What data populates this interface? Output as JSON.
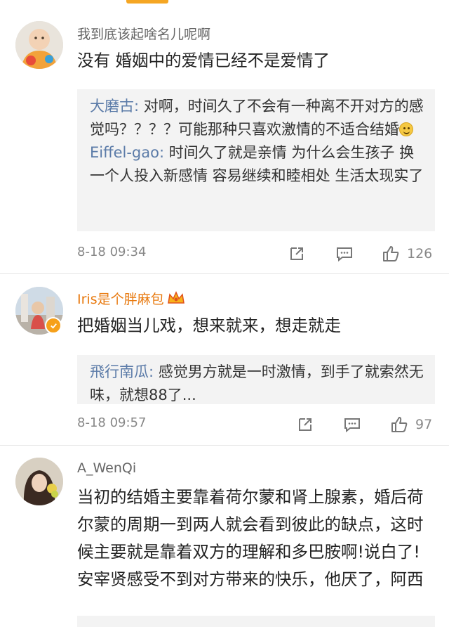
{
  "comments": [
    {
      "username": "我到底该起啥名儿呢啊",
      "content": "没有 婚姻中的爱情已经不是爱情了",
      "replies": [
        {
          "name": "大磨古",
          "sep": ": ",
          "text": "对啊，时间久了不会有一种离不开对方的感觉吗？？？？可能那种只喜欢激情的不适合结婚"
        },
        {
          "name": "Eiffel-gao",
          "sep": ": ",
          "text": "时间久了就是亲情 为什么会生孩子 换一个人投入新感情 容易继续和睦相处 生活太现实了"
        }
      ],
      "time": "8-18 09:34",
      "likes": "126"
    },
    {
      "username": "Iris是个胖麻包",
      "content": "把婚姻当儿戏，想来就来，想走就走",
      "replies": [
        {
          "name": "飛行南瓜",
          "sep": ": ",
          "text": "感觉男方就是一时激情，到手了就索然无味，就想88了..."
        }
      ],
      "time": "8-18 09:57",
      "likes": "97"
    },
    {
      "username": "A_WenQi",
      "content": "当初的结婚主要靠着荷尔蒙和肾上腺素，婚后荷尔蒙的周期一到两人就会看到彼此的缺点，这时候主要就是靠着双方的理解和多巴胺啊!说白了!安宰贤感受不到对方带来的快乐，他厌了，阿西"
    }
  ],
  "colors": {
    "accent": "#f5a623",
    "reply_name": "#5b7ba8",
    "vip_name": "#e87a10",
    "meta": "#888888",
    "reply_bg": "#f3f3f3"
  },
  "icons": [
    "share-icon",
    "comment-icon",
    "like-icon",
    "crown-icon",
    "verified-icon",
    "smile-emoji"
  ]
}
